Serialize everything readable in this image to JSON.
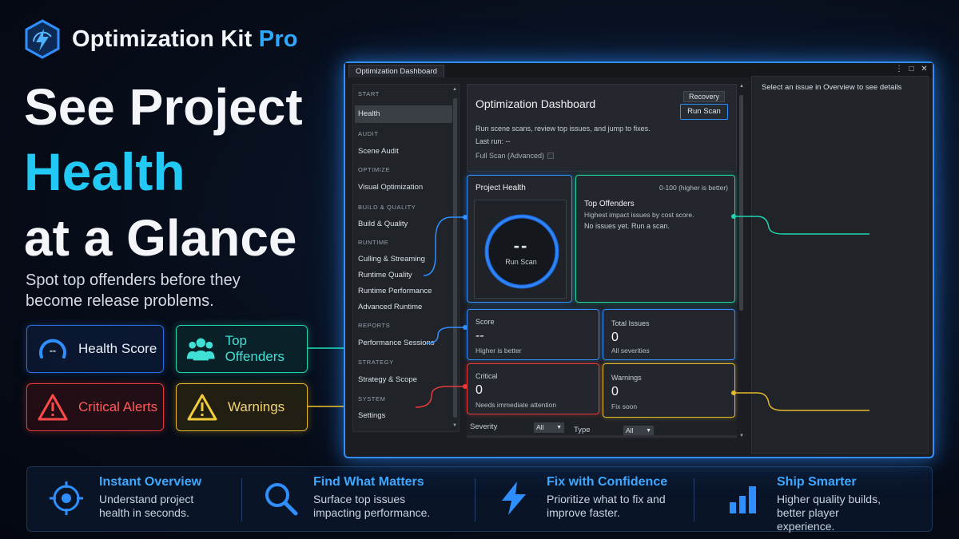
{
  "brand": {
    "name": "Optimization Kit",
    "suffix": "Pro"
  },
  "hero": {
    "line1": "See Project",
    "line2": "Health",
    "line3": "at a Glance",
    "subtitle": "Spot top offenders before they become release problems."
  },
  "pills": {
    "health_score": "Health Score",
    "top_offenders": "Top Offenders",
    "critical_alerts": "Critical Alerts",
    "warnings": "Warnings",
    "health_icon_text": "--"
  },
  "features": [
    {
      "title": "Instant Overview",
      "desc": "Understand project health in seconds.",
      "icon": "target-icon"
    },
    {
      "title": "Find What Matters",
      "desc": "Surface top issues impacting performance.",
      "icon": "magnifier-icon"
    },
    {
      "title": "Fix with Confidence",
      "desc": "Prioritize what to fix and improve faster.",
      "icon": "lightning-icon"
    },
    {
      "title": "Ship Smarter",
      "desc": "Higher quality builds, better player experience.",
      "icon": "bar-chart-icon"
    }
  ],
  "window": {
    "tab": "Optimization Dashboard",
    "controls": [
      "⋮",
      "□",
      "✕"
    ]
  },
  "sidebar": {
    "sections": [
      {
        "label": "START",
        "items": [
          "Health"
        ]
      },
      {
        "label": "AUDIT",
        "items": [
          "Scene Audit"
        ]
      },
      {
        "label": "OPTIMIZE",
        "items": [
          "Visual Optimization"
        ]
      },
      {
        "label": "BUILD & QUALITY",
        "items": [
          "Build & Quality"
        ]
      },
      {
        "label": "RUNTIME",
        "items": [
          "Culling & Streaming",
          "Runtime Quality",
          "Runtime Performance",
          "Advanced Runtime"
        ]
      },
      {
        "label": "REPORTS",
        "items": [
          "Performance Sessions"
        ]
      },
      {
        "label": "STRATEGY",
        "items": [
          "Strategy & Scope"
        ]
      },
      {
        "label": "SYSTEM",
        "items": [
          "Settings"
        ]
      }
    ],
    "active": "Health"
  },
  "header": {
    "title": "Optimization Dashboard",
    "recovery": "Recovery",
    "run_scan": "Run Scan",
    "description": "Run scene scans, review top issues, and jump to fixes.",
    "last_run": "Last run: --",
    "full_scan": "Full Scan (Advanced)"
  },
  "health_card": {
    "title": "Project Health",
    "value": "--",
    "label": "Run Scan"
  },
  "offenders_card": {
    "range": "0-100 (higher is better)",
    "title": "Top Offenders",
    "subtitle": "Highest impact issues by cost score.",
    "empty": "No issues yet. Run a scan."
  },
  "stats": {
    "score": {
      "label": "Score",
      "value": "--",
      "sub": "Higher is better"
    },
    "total": {
      "label": "Total Issues",
      "value": "0",
      "sub": "All severities"
    },
    "critical": {
      "label": "Critical",
      "value": "0",
      "sub": "Needs immediate attention"
    },
    "warnings": {
      "label": "Warnings",
      "value": "0",
      "sub": "Fix soon"
    }
  },
  "filters": {
    "severity_label": "Severity",
    "severity_value": "All",
    "type_label": "Type",
    "type_value": "All"
  },
  "detail": {
    "placeholder": "Select an issue in Overview to see details"
  },
  "colors": {
    "accent_blue": "#2f8fff",
    "teal": "#1fd6b0",
    "red": "#e53b3b",
    "yellow": "#e6b92a",
    "cyan_headline": "#22c9f5"
  }
}
